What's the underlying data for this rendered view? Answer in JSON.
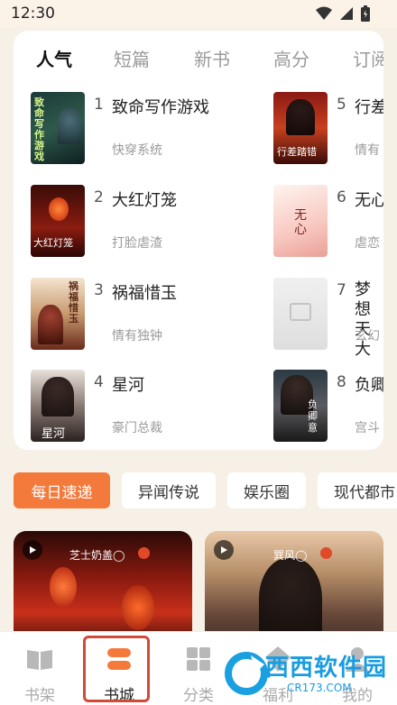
{
  "status_bar": {
    "time": "12:30"
  },
  "rank_tabs": [
    "人气",
    "短篇",
    "新书",
    "高分",
    "订阅"
  ],
  "books": [
    {
      "rank": "1",
      "title": "致命写作游戏",
      "tag": "快穿系统",
      "cover_text": "致命写作游戏"
    },
    {
      "rank": "2",
      "title": "大红灯笼",
      "tag": "打脸虐渣",
      "cover_text": "大红灯笼"
    },
    {
      "rank": "3",
      "title": "祸福惜玉",
      "tag": "情有独钟",
      "cover_text": "祸福惜玉"
    },
    {
      "rank": "4",
      "title": "星河",
      "tag": "豪门总裁",
      "cover_text": "星河"
    },
    {
      "rank": "5",
      "title": "行差",
      "tag": "情有",
      "cover_text": "行差踏错"
    },
    {
      "rank": "6",
      "title": "无心",
      "tag": "虐恋",
      "cover_text": "无心"
    },
    {
      "rank": "7",
      "title": "梦想天大",
      "tag": "玄幻",
      "cover_text": ""
    },
    {
      "rank": "8",
      "title": "负卿",
      "tag": "宫斗",
      "cover_text": "负卿意"
    }
  ],
  "chips": [
    "每日速递",
    "异闻传说",
    "娱乐圈",
    "现代都市"
  ],
  "feed": [
    {
      "author": "芝士奶盖◯"
    },
    {
      "author": "巽风◯"
    }
  ],
  "tab_bar": [
    "书架",
    "书城",
    "分类",
    "福利",
    "我的"
  ],
  "watermark": {
    "text": "西西软件园",
    "url": "CR173.COM"
  },
  "colors": {
    "accent": "#f47a3c",
    "highlight": "#d24a3a"
  }
}
